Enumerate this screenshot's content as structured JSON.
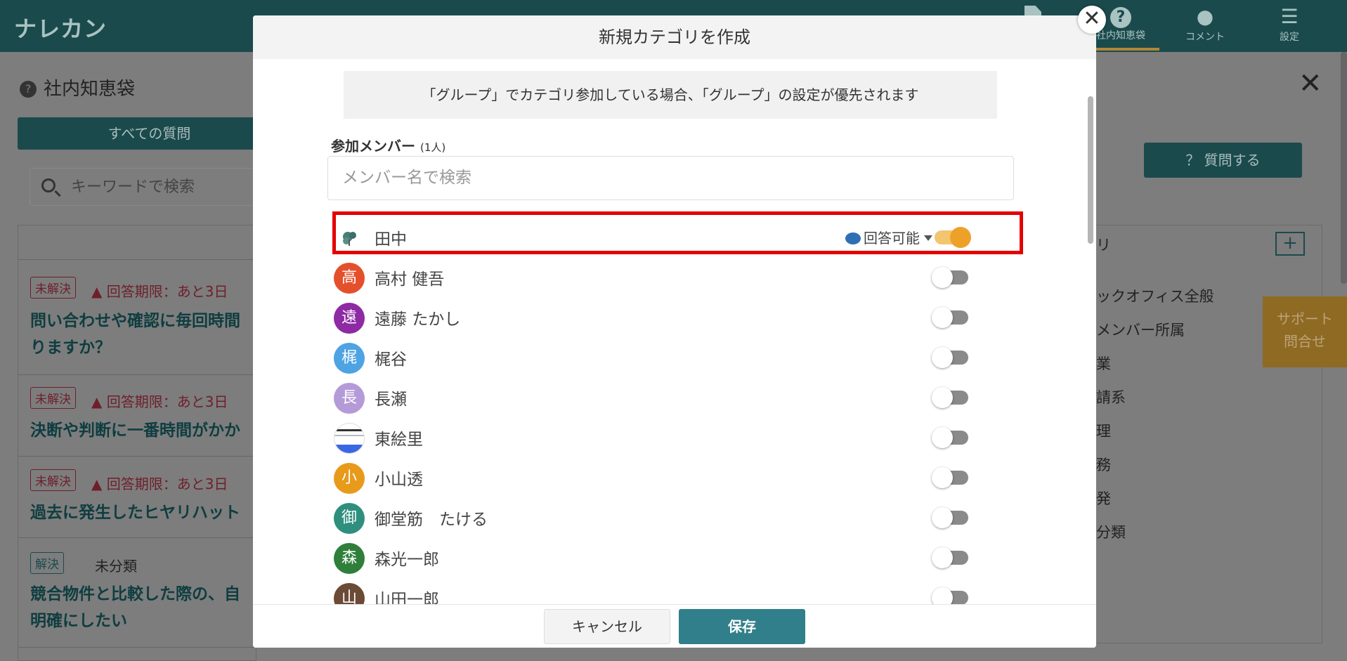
{
  "app": {
    "logo": "ナレカン"
  },
  "topnav": [
    {
      "label": "社内知恵袋",
      "icon": "help-icon"
    },
    {
      "label": "コメント",
      "icon": "comment-icon"
    },
    {
      "label": "設定",
      "icon": "menu-icon"
    }
  ],
  "background": {
    "page_title": "社内知恵袋",
    "all_questions_tab": "すべての質問",
    "keyword_placeholder": "キーワードで検索",
    "ask_button": "？ 質問する",
    "questions": [
      {
        "status": "未解決",
        "deadline": "回答期限：あと3日",
        "title_line1": "問い合わせや確認に毎回時間",
        "title_line2": "りますか？"
      },
      {
        "status": "未解決",
        "deadline": "回答期限：あと3日",
        "title_line1": "決断や判断に一番時間がかか"
      },
      {
        "status": "未解決",
        "deadline": "回答期限：あと3日",
        "title_line1": "過去に発生したヒヤリハット"
      },
      {
        "status": "解決",
        "category": "未分類",
        "title_line1": "競合物件と比較した際の、自",
        "title_line2": "明確にしたい"
      }
    ],
    "right_panel_header": "リ",
    "categories": [
      "ックオフィス全般",
      "メンバー所属",
      "業",
      "請系",
      "理",
      "務",
      "発",
      "分類"
    ],
    "support": {
      "line1": "サポート",
      "line2": "問合せ"
    }
  },
  "modal": {
    "title": "新規カテゴリを作成",
    "notice": "「グループ」でカテゴリ参加している場合、「グループ」の設定が優先されます",
    "members_label": "参加メンバー",
    "members_count": "(1人)",
    "search_placeholder": "メンバー名で検索",
    "role_label": "回答可能",
    "members": [
      {
        "name": "田中",
        "avatar": "",
        "color": "#ffffff",
        "enabled": true
      },
      {
        "name": "高村 健吾",
        "avatar": "高",
        "color": "#e4502c",
        "enabled": false
      },
      {
        "name": "遠藤 たかし",
        "avatar": "遠",
        "color": "#8e2aa3",
        "enabled": false
      },
      {
        "name": "梶谷",
        "avatar": "梶",
        "color": "#4ea3e3",
        "enabled": false
      },
      {
        "name": "長瀬",
        "avatar": "長",
        "color": "#b59ad8",
        "enabled": false
      },
      {
        "name": "東絵里",
        "avatar": "",
        "color": "#ffffff",
        "enabled": false
      },
      {
        "name": "小山透",
        "avatar": "小",
        "color": "#e89a1b",
        "enabled": false
      },
      {
        "name": "御堂筋　たける",
        "avatar": "御",
        "color": "#2f8f7e",
        "enabled": false
      },
      {
        "name": "森光一郎",
        "avatar": "森",
        "color": "#2f7f3a",
        "enabled": false
      },
      {
        "name": "山田一郎",
        "avatar": "山",
        "color": "#6b4b36",
        "enabled": false
      }
    ],
    "cancel_label": "キャンセル",
    "save_label": "保存"
  }
}
